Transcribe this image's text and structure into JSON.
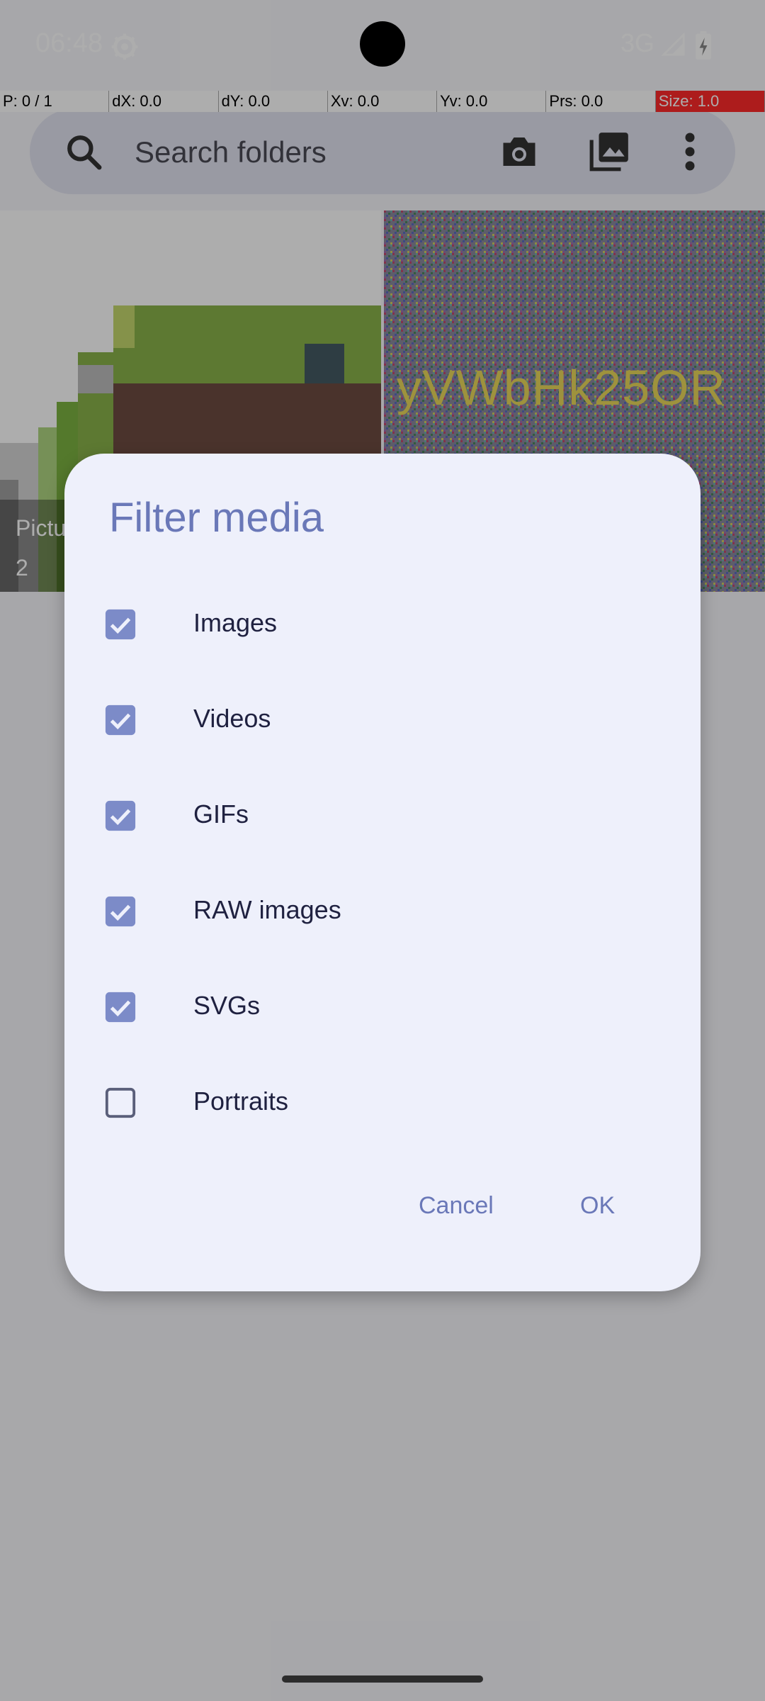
{
  "status": {
    "time": "06:48",
    "network": "3G",
    "icons": [
      "settings-icon",
      "signal-icon",
      "battery-charging-icon"
    ]
  },
  "debug": {
    "cells": [
      "P: 0 / 1",
      "dX: 0.0",
      "dY: 0.0",
      "Xv: 0.0",
      "Yv: 0.0",
      "Prs: 0.0",
      "Size: 1.0"
    ]
  },
  "search": {
    "placeholder": "Search folders",
    "icons": [
      "search-icon",
      "camera-icon",
      "gallery-icon",
      "more-vert-icon"
    ]
  },
  "folders": [
    {
      "name": "Pictu",
      "count": "2"
    },
    {
      "name": "",
      "overlay_text": "yVWbHk25OR"
    }
  ],
  "dialog": {
    "title": "Filter media",
    "options": [
      {
        "label": "Images",
        "checked": true
      },
      {
        "label": "Videos",
        "checked": true
      },
      {
        "label": "GIFs",
        "checked": true
      },
      {
        "label": "RAW images",
        "checked": true
      },
      {
        "label": "SVGs",
        "checked": true
      },
      {
        "label": "Portraits",
        "checked": false
      }
    ],
    "cancel_label": "Cancel",
    "ok_label": "OK"
  },
  "colors": {
    "accent": "#6a78b8",
    "dialog_bg": "#eef0fb",
    "checkbox": "#7c8bc8"
  }
}
